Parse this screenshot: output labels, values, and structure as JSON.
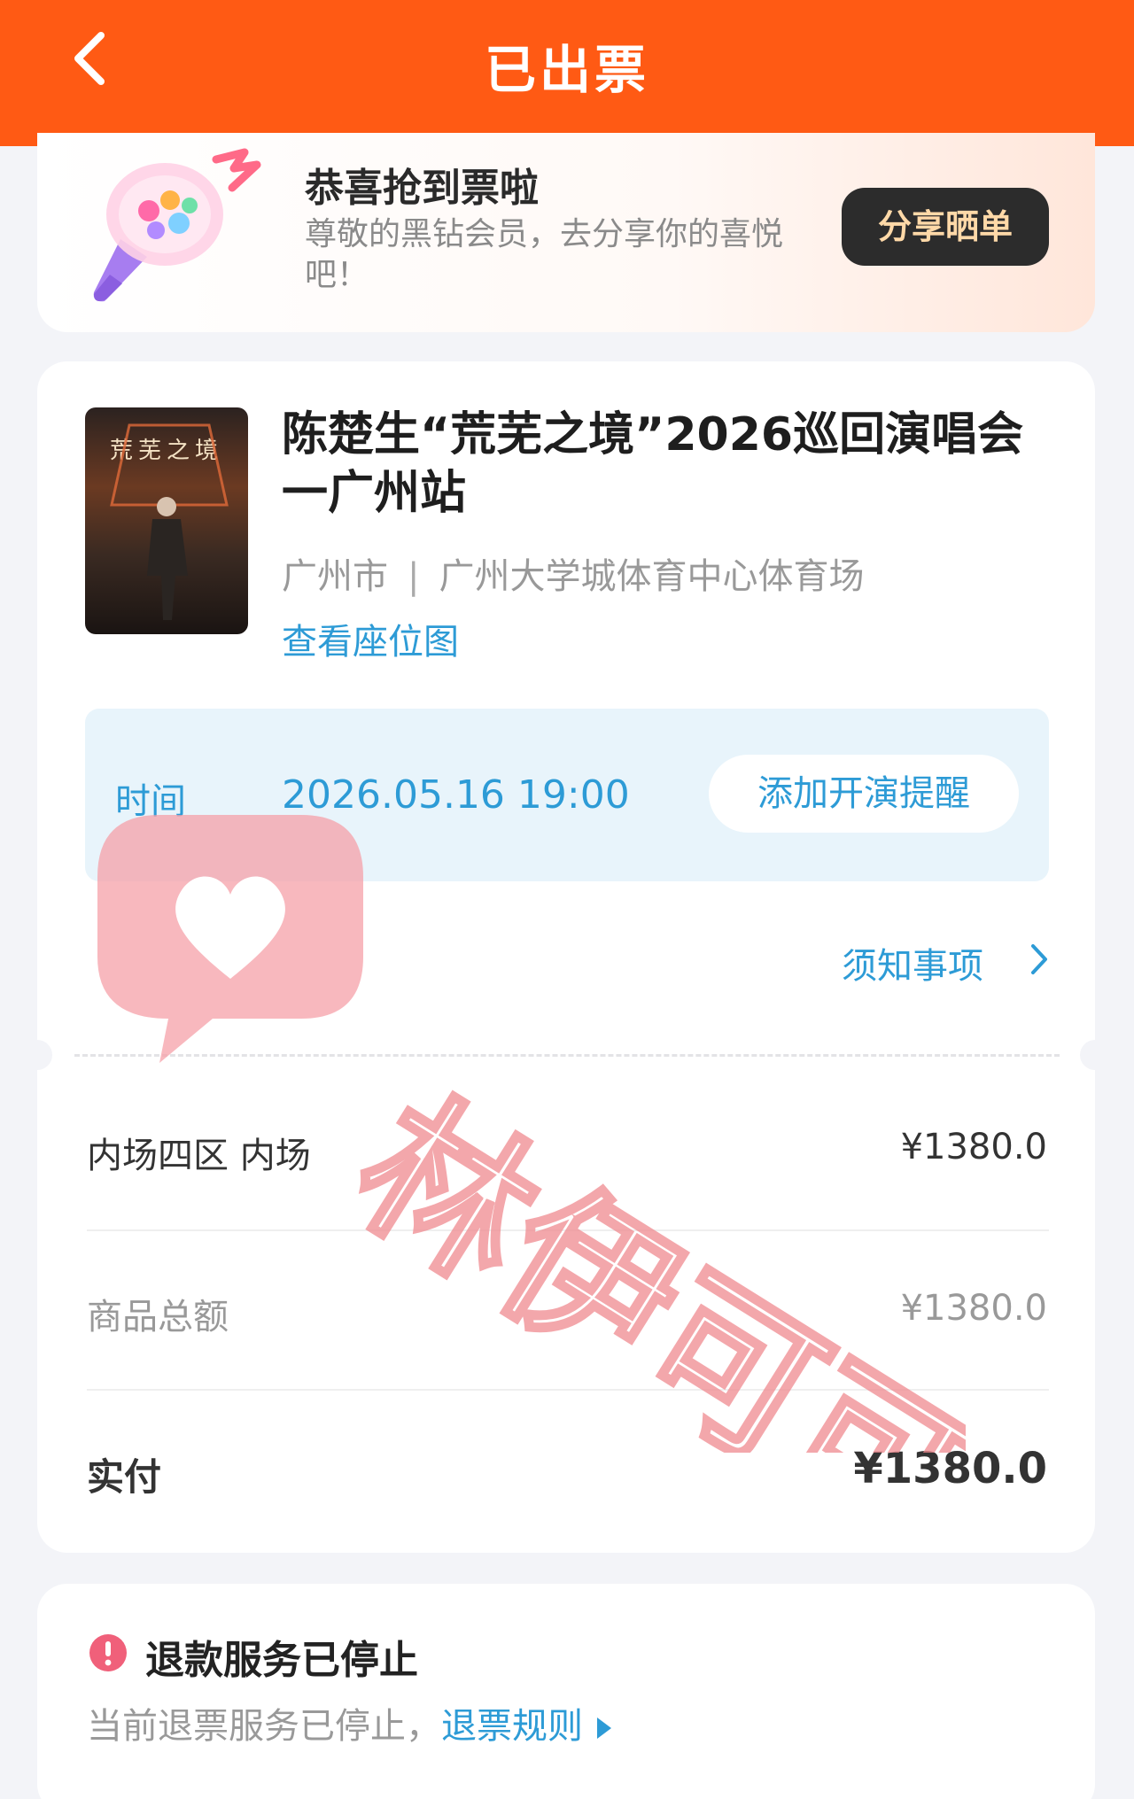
{
  "header": {
    "title": "已出票",
    "back_icon": "chevron-left-icon"
  },
  "share": {
    "title": "恭喜抢到票啦",
    "subtitle": "尊敬的黑钻会员，去分享你的喜悦吧！",
    "button_label": "分享晒单"
  },
  "event": {
    "poster_title": "荒芜之境",
    "title": "陈楚生“荒芜之境”2026巡回演唱会一广州站",
    "city": "广州市",
    "separator": "|",
    "venue": "广州大学城体育中心体育场",
    "seat_map_link": "查看座位图"
  },
  "time": {
    "label": "时间",
    "value": "2026.05.16 19:00",
    "remind_button": "添加开演提醒"
  },
  "notice_link": "须知事项",
  "order": {
    "ticket": {
      "label": "内场四区 内场",
      "price": "¥1380.0"
    },
    "subtotal": {
      "label": "商品总额",
      "price": "¥1380.0"
    },
    "paid": {
      "label": "实付",
      "price": "¥1380.0"
    }
  },
  "refund": {
    "title": "退款服务已停止",
    "description": "当前退票服务已停止，",
    "rules_link": "退票规则"
  },
  "watermark_text": "林伊可可",
  "colors": {
    "brand_orange": "#ff5a14",
    "link_blue": "#2d9bd6",
    "warning_pink": "#f0607a"
  }
}
